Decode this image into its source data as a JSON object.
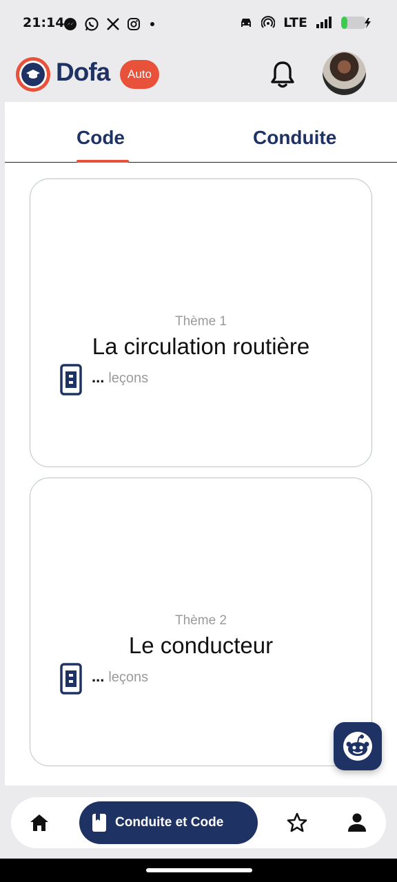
{
  "status_bar": {
    "time": "21:14",
    "network": "LTE",
    "left_icons": [
      "messenger-icon",
      "whatsapp-icon",
      "x-icon",
      "instagram-icon",
      "dot-icon"
    ],
    "right_icons": [
      "car-icon",
      "hotspot-icon",
      "signal-icon",
      "battery-charging-icon"
    ]
  },
  "header": {
    "brand": "Dofa",
    "badge": "Auto",
    "colors": {
      "brand": "#1f3264",
      "accent": "#e8513a"
    }
  },
  "tabs": [
    {
      "label": "Code",
      "active": true
    },
    {
      "label": "Conduite",
      "active": false
    }
  ],
  "themes": [
    {
      "label": "Thème 1",
      "title": "La circulation routière",
      "lessons_count": "...",
      "lessons_label": "leçons"
    },
    {
      "label": "Thème 2",
      "title": "Le conducteur",
      "lessons_count": "...",
      "lessons_label": "leçons"
    }
  ],
  "bottom_nav": {
    "items": [
      {
        "icon": "home-icon"
      },
      {
        "icon": "book-icon",
        "label": "Conduite et Code",
        "active": true
      },
      {
        "icon": "star-icon"
      },
      {
        "icon": "person-icon"
      }
    ]
  }
}
